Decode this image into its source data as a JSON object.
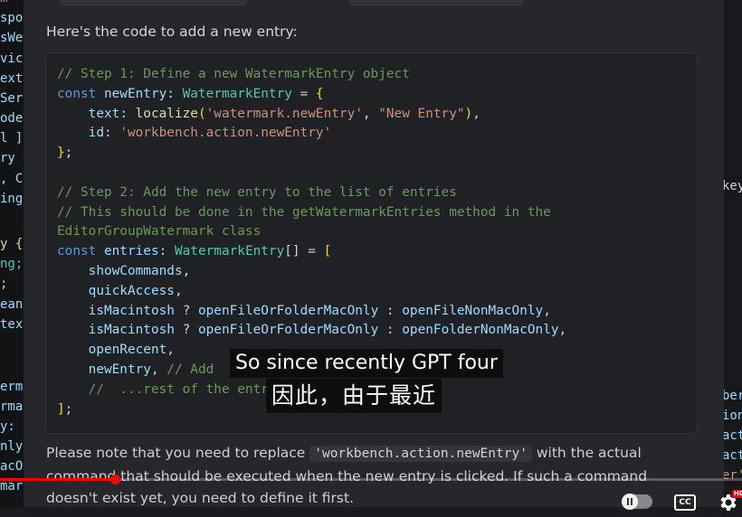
{
  "left_editor": {
    "lines": [
      {
        "text": "m",
        "color": "#c586c0"
      },
      {
        "text": "spo",
        "color": "#9cdcfe"
      },
      {
        "text": "sWe",
        "color": "#9cdcfe"
      },
      {
        "text": "vic",
        "color": "#9cdcfe"
      },
      {
        "text": "ext",
        "color": "#9cdcfe"
      },
      {
        "text": "Ser",
        "color": "#9cdcfe"
      },
      {
        "text": "ode",
        "color": "#9cdcfe"
      },
      {
        "text": "l ]",
        "color": "#9cdcfe"
      },
      {
        "text": "ry",
        "color": "#9cdcfe"
      },
      {
        "text": ", C",
        "color": "#9cdcfe"
      },
      {
        "text": "ing",
        "color": "#9cdcfe"
      },
      {
        "text": "y {",
        "color": "#dcdcaa"
      },
      {
        "text": "ng;",
        "color": "#4ec9b0"
      },
      {
        "text": ";",
        "color": "#d4d4d4"
      },
      {
        "text": "ean",
        "color": "#9cdcfe"
      },
      {
        "text": "tex",
        "color": "#9cdcfe"
      },
      {
        "text": "erm",
        "color": "#9cdcfe"
      },
      {
        "text": "rma",
        "color": "#9cdcfe"
      },
      {
        "text": "y:",
        "color": "#9cdcfe"
      },
      {
        "text": "nly",
        "color": "#9cdcfe"
      },
      {
        "text": "acO",
        "color": "#9cdcfe"
      },
      {
        "text": "mar",
        "color": "#9cdcfe"
      }
    ]
  },
  "right_editor": {
    "lines": [
      {
        "text": "key",
        "color": "#d4d4d4"
      },
      {
        "text": "ber",
        "color": "#9cdcfe"
      },
      {
        "text": "ion",
        "color": "#9cdcfe"
      },
      {
        "text": "act",
        "color": "#9cdcfe"
      },
      {
        "text": "act",
        "color": "#9cdcfe"
      },
      {
        "text": "er'",
        "color": "#ce9178"
      }
    ]
  },
  "chat": {
    "intro": "Here's the code to add a new entry:",
    "code_lines": [
      [
        {
          "t": "// Step 1: Define a new WatermarkEntry object",
          "c": "cm"
        }
      ],
      [
        {
          "t": "const ",
          "c": "kw"
        },
        {
          "t": "newEntry",
          "c": "vr"
        },
        {
          "t": ": ",
          "c": "pl"
        },
        {
          "t": "WatermarkEntry",
          "c": "ty"
        },
        {
          "t": " = ",
          "c": "pl"
        },
        {
          "t": "{",
          "c": "br"
        }
      ],
      [
        {
          "t": "    text",
          "c": "vr"
        },
        {
          "t": ": ",
          "c": "pl"
        },
        {
          "t": "localize",
          "c": "fn"
        },
        {
          "t": "(",
          "c": "br"
        },
        {
          "t": "'watermark.newEntry'",
          "c": "st"
        },
        {
          "t": ", ",
          "c": "pl"
        },
        {
          "t": "\"New Entry\"",
          "c": "st"
        },
        {
          "t": ")",
          "c": "br"
        },
        {
          "t": ",",
          "c": "pl"
        }
      ],
      [
        {
          "t": "    id",
          "c": "vr"
        },
        {
          "t": ": ",
          "c": "pl"
        },
        {
          "t": "'workbench.action.newEntry'",
          "c": "st"
        }
      ],
      [
        {
          "t": "}",
          "c": "br"
        },
        {
          "t": ";",
          "c": "pl"
        }
      ],
      [
        {
          "t": "",
          "c": "pl"
        }
      ],
      [
        {
          "t": "// Step 2: Add the new entry to the list of entries",
          "c": "cm"
        }
      ],
      [
        {
          "t": "// This should be done in the getWatermarkEntries method in the",
          "c": "cm"
        }
      ],
      [
        {
          "t": "EditorGroupWatermark class",
          "c": "cm"
        }
      ],
      [
        {
          "t": "const ",
          "c": "kw"
        },
        {
          "t": "entries",
          "c": "vr"
        },
        {
          "t": ": ",
          "c": "pl"
        },
        {
          "t": "WatermarkEntry",
          "c": "ty"
        },
        {
          "t": "[]",
          "c": "pl"
        },
        {
          "t": " = ",
          "c": "pl"
        },
        {
          "t": "[",
          "c": "br"
        }
      ],
      [
        {
          "t": "    showCommands",
          "c": "vr"
        },
        {
          "t": ",",
          "c": "pl"
        }
      ],
      [
        {
          "t": "    quickAccess",
          "c": "vr"
        },
        {
          "t": ",",
          "c": "pl"
        }
      ],
      [
        {
          "t": "    isMacintosh",
          "c": "vr"
        },
        {
          "t": " ? ",
          "c": "pl"
        },
        {
          "t": "openFileOrFolderMacOnly",
          "c": "vr"
        },
        {
          "t": " : ",
          "c": "pl"
        },
        {
          "t": "openFileNonMacOnly",
          "c": "vr"
        },
        {
          "t": ",",
          "c": "pl"
        }
      ],
      [
        {
          "t": "    isMacintosh",
          "c": "vr"
        },
        {
          "t": " ? ",
          "c": "pl"
        },
        {
          "t": "openFileOrFolderMacOnly",
          "c": "vr"
        },
        {
          "t": " : ",
          "c": "pl"
        },
        {
          "t": "openFolderNonMacOnly",
          "c": "vr"
        },
        {
          "t": ",",
          "c": "pl"
        }
      ],
      [
        {
          "t": "    openRecent",
          "c": "vr"
        },
        {
          "t": ",",
          "c": "pl"
        }
      ],
      [
        {
          "t": "    newEntry",
          "c": "vr"
        },
        {
          "t": ", ",
          "c": "pl"
        },
        {
          "t": "// Add",
          "c": "cm"
        }
      ],
      [
        {
          "t": "    //  ...rest of the entr",
          "c": "cm"
        }
      ],
      [
        {
          "t": "]",
          "c": "br"
        },
        {
          "t": ";",
          "c": "pl"
        }
      ]
    ],
    "note_before": "Please note that you need to replace ",
    "note_code": "'workbench.action.newEntry'",
    "note_after": " with the actual command that should be executed when the new entry is clicked. If such a command doesn't exist yet, you need to define it first."
  },
  "video": {
    "subtitle_en": "So since recently GPT four",
    "subtitle_zh": "因此，由于最近",
    "progress": 0.155,
    "cc_label": "CC",
    "hd_label": "HD",
    "accent": "#ff0000"
  },
  "icons": {
    "pause": "pause-toggle-icon",
    "captions": "closed-captions-icon",
    "settings": "gear-icon"
  }
}
